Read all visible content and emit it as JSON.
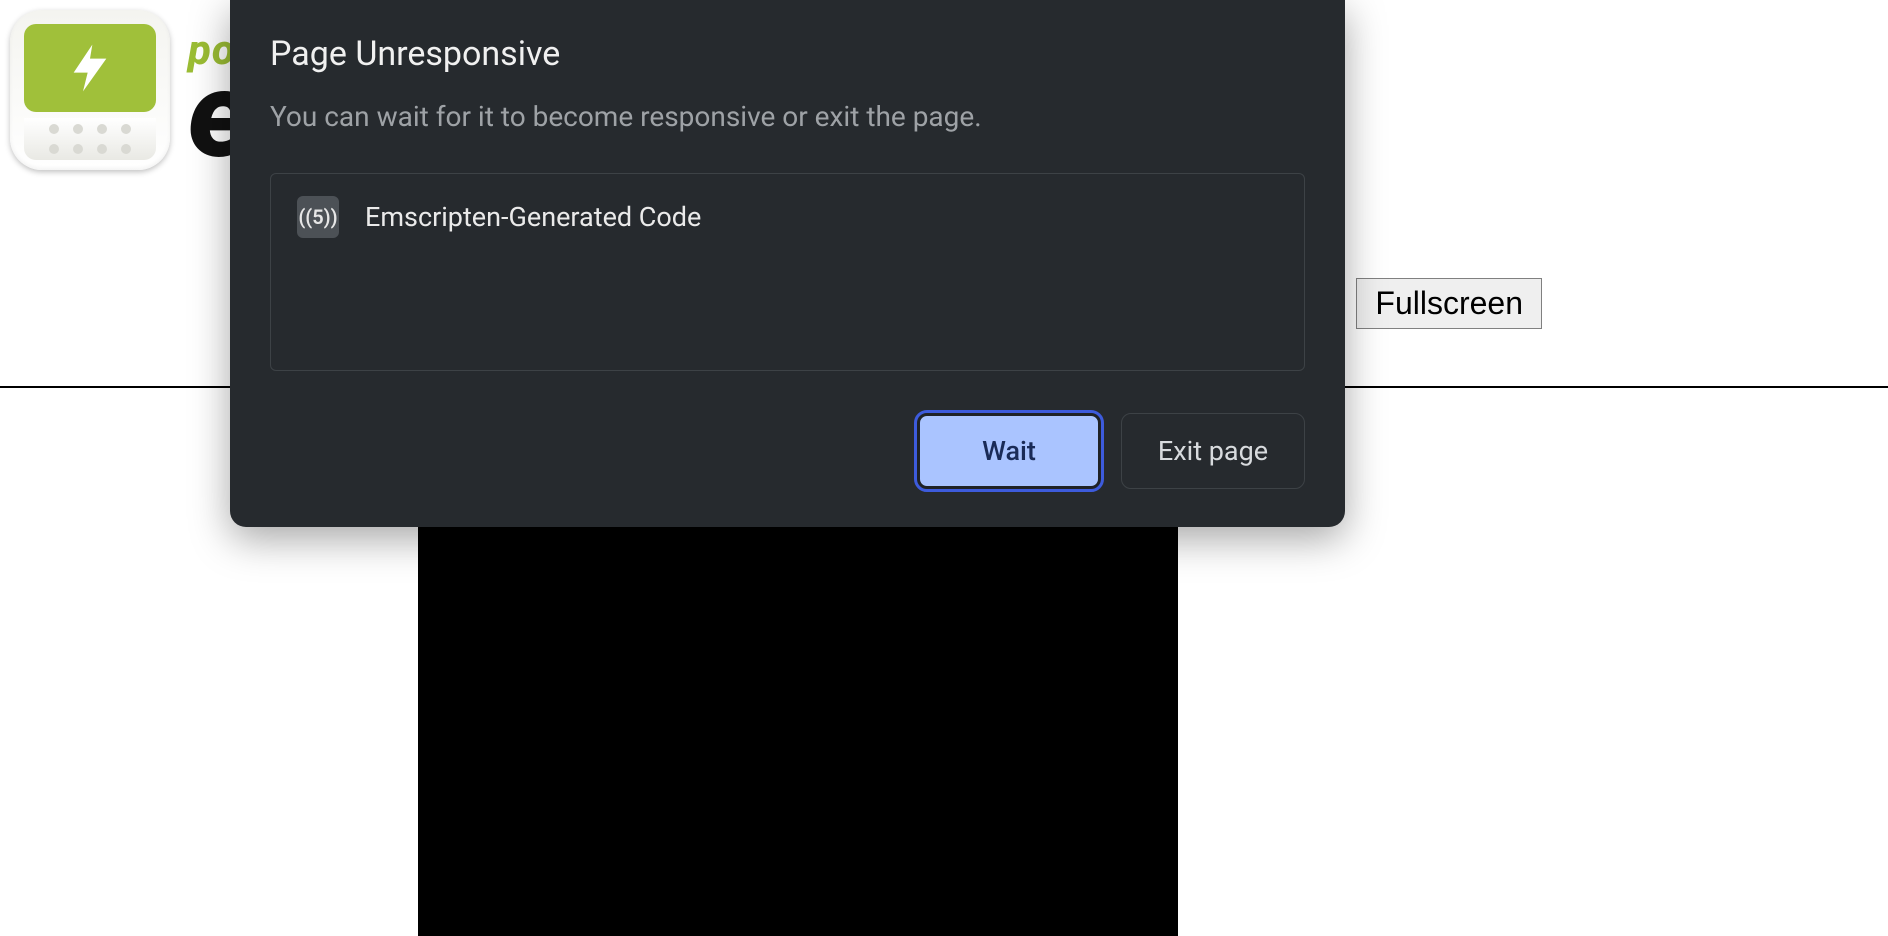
{
  "page": {
    "wordmark_line1": "po",
    "wordmark_line2": "e",
    "fullscreen_label": "Fullscreen"
  },
  "dialog": {
    "title": "Page Unresponsive",
    "description": "You can wait for it to become responsive or exit the page.",
    "tab": {
      "favicon_label": "((5))",
      "title": "Emscripten-Generated Code"
    },
    "actions": {
      "wait": "Wait",
      "exit": "Exit page"
    }
  }
}
